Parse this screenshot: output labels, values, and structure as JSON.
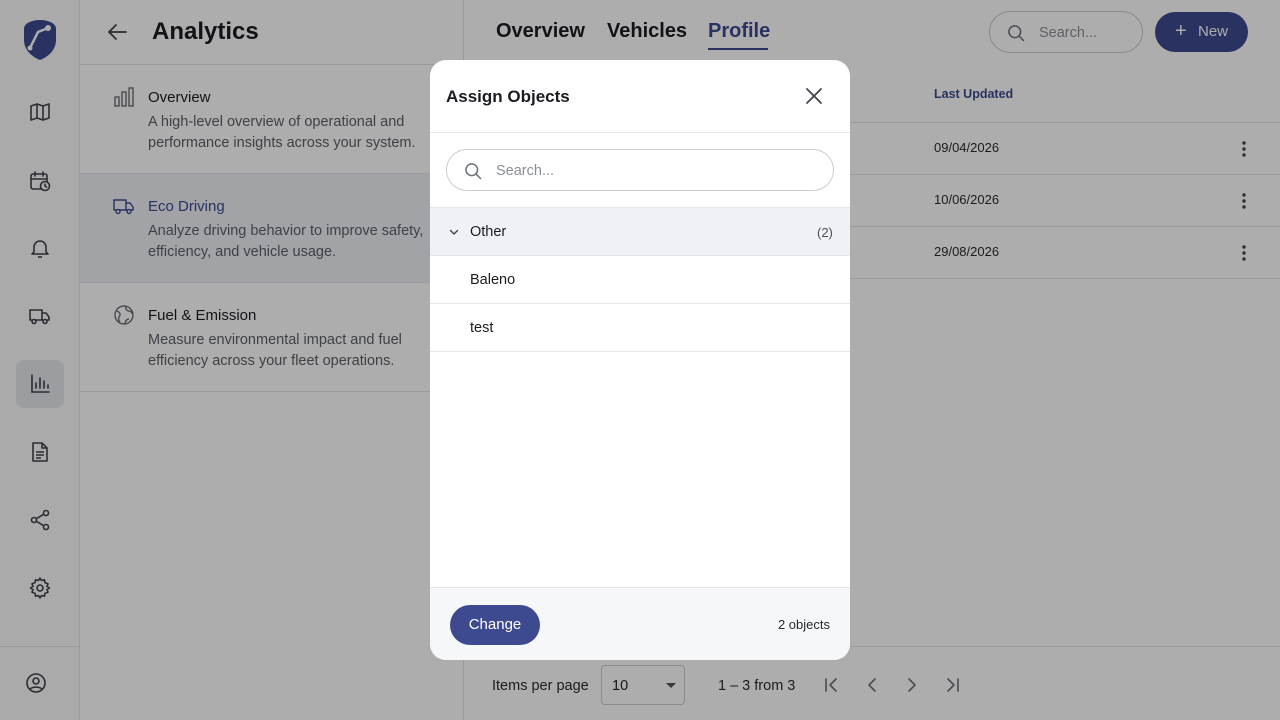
{
  "colors": {
    "accent": "#3d4a8f",
    "overlay": "rgba(0,0,0,0.32)"
  },
  "rail": {
    "logo": "shield-logo",
    "items": [
      {
        "icon": "map-icon"
      },
      {
        "icon": "calendar-clock-icon"
      },
      {
        "icon": "bell-icon"
      },
      {
        "icon": "truck-icon"
      },
      {
        "icon": "bar-chart-icon",
        "active": true
      },
      {
        "icon": "document-icon"
      },
      {
        "icon": "share-icon"
      },
      {
        "icon": "gear-icon"
      }
    ],
    "account_icon": "user-circle-icon"
  },
  "panel": {
    "title": "Analytics",
    "items": [
      {
        "title": "Overview",
        "desc": "A high-level overview of operational and performance insights across your system.",
        "icon": "bar-chart-icon"
      },
      {
        "title": "Eco Driving",
        "desc": "Analyze driving behavior to improve safety, efficiency, and vehicle usage.",
        "icon": "truck-icon",
        "active": true
      },
      {
        "title": "Fuel & Emission",
        "desc": "Measure environmental impact and fuel efficiency across your fleet operations.",
        "icon": "globe-icon"
      }
    ]
  },
  "main": {
    "tabs": [
      {
        "label": "Overview"
      },
      {
        "label": "Vehicles"
      },
      {
        "label": "Profile",
        "active": true
      }
    ],
    "search": {
      "placeholder": "Search..."
    },
    "new_button": "New",
    "table": {
      "column_last_updated": "Last Updated",
      "rows": [
        {
          "last_updated": "09/04/2026"
        },
        {
          "last_updated": "10/06/2026"
        },
        {
          "last_updated": "29/08/2026"
        }
      ]
    },
    "pagination": {
      "items_per_page_label": "Items per page",
      "items_per_page": "10",
      "range": "1 – 3 from 3"
    }
  },
  "modal": {
    "title": "Assign Objects",
    "search_placeholder": "Search...",
    "group": {
      "name": "Other",
      "count": "(2)"
    },
    "objects": [
      {
        "name": "Baleno"
      },
      {
        "name": "test"
      }
    ],
    "change_button": "Change",
    "object_count": "2 objects"
  }
}
